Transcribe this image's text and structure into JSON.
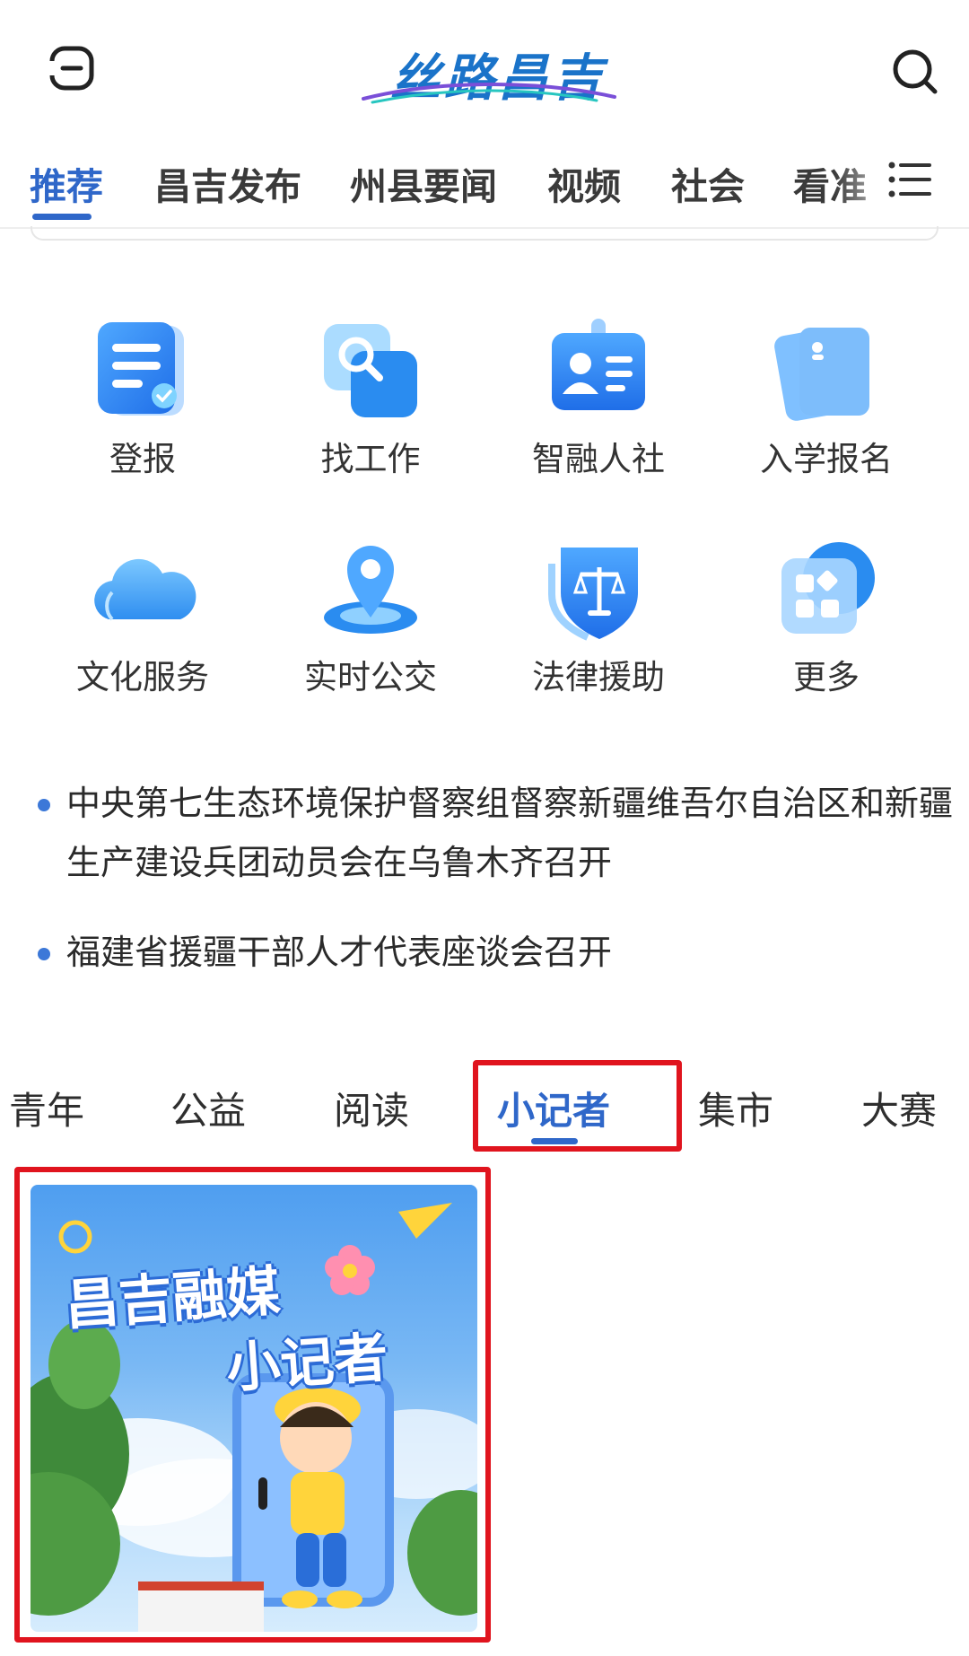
{
  "header": {
    "logo_text": "丝路昌吉",
    "menu_icon": "menu-icon",
    "search_icon": "search-icon"
  },
  "top_tabs": [
    {
      "label": "推荐",
      "active": true
    },
    {
      "label": "昌吉发布",
      "active": false
    },
    {
      "label": "州县要闻",
      "active": false
    },
    {
      "label": "视频",
      "active": false
    },
    {
      "label": "社会",
      "active": false
    },
    {
      "label": "看准",
      "active": false
    }
  ],
  "services": [
    {
      "label": "登报",
      "icon": "newspaper-form-icon"
    },
    {
      "label": "找工作",
      "icon": "job-search-icon"
    },
    {
      "label": "智融人社",
      "icon": "id-badge-icon"
    },
    {
      "label": "入学报名",
      "icon": "enrollment-card-icon"
    },
    {
      "label": "文化服务",
      "icon": "cloud-icon"
    },
    {
      "label": "实时公交",
      "icon": "location-pin-icon"
    },
    {
      "label": "法律援助",
      "icon": "law-shield-icon"
    },
    {
      "label": "更多",
      "icon": "more-apps-icon"
    }
  ],
  "news": [
    {
      "title": "中央第七生态环境保护督察组督察新疆维吾尔自治区和新疆生产建设兵团动员会在乌鲁木齐召开"
    },
    {
      "title": "福建省援疆干部人才代表座谈会召开"
    }
  ],
  "sub_tabs": [
    {
      "label": "青年",
      "active": false
    },
    {
      "label": "公益",
      "active": false
    },
    {
      "label": "阅读",
      "active": false
    },
    {
      "label": "小记者",
      "active": true
    },
    {
      "label": "集市",
      "active": false
    },
    {
      "label": "大赛",
      "active": false
    }
  ],
  "card": {
    "title_line1": "昌吉融媒",
    "title_line2": "小记者"
  },
  "colors": {
    "accent": "#2f67c9",
    "highlight_box": "#e0141e",
    "news_dot": "#3c78d8"
  }
}
